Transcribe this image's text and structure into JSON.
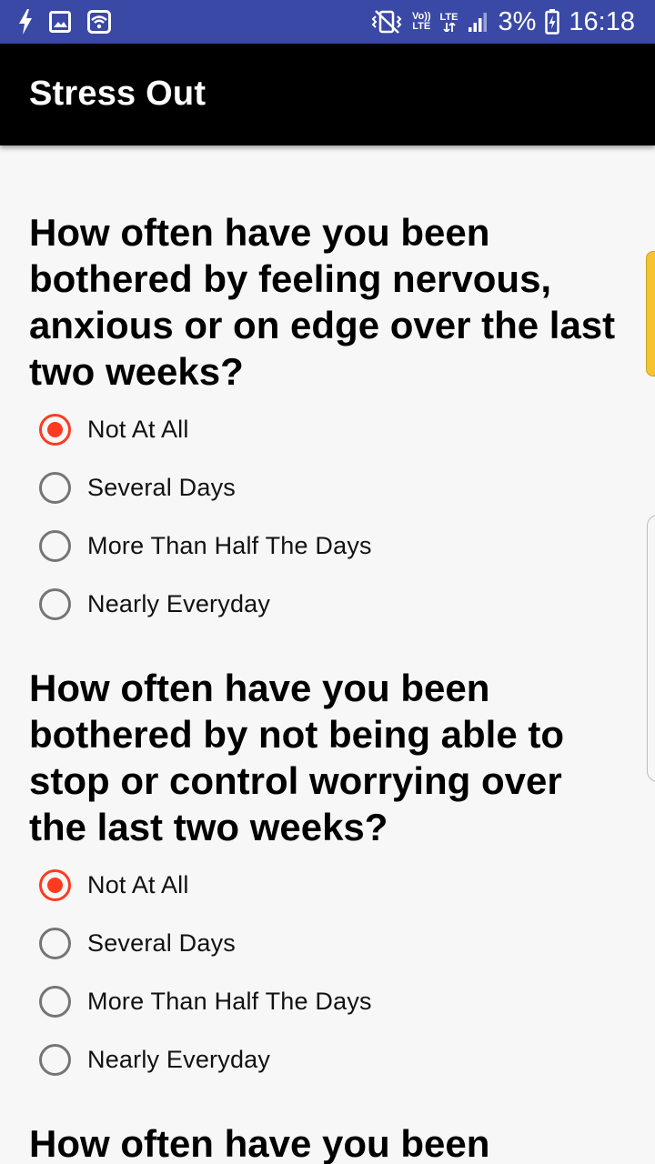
{
  "status_bar": {
    "battery_percent": "3%",
    "time": "16:18",
    "volte_label_top": "Vo))",
    "volte_label_bottom": "LTE",
    "lte_label": "LTE",
    "icons": [
      "flash-icon",
      "image-icon",
      "wifi-icon",
      "vibrate-icon",
      "volte-icon",
      "lte-data-icon",
      "signal-icon",
      "battery-charging-icon"
    ],
    "background_color": "#3a48a6"
  },
  "app_bar": {
    "title": "Stress Out",
    "background_color": "#000000"
  },
  "questions": [
    {
      "text": "How often have you been bothered by feeling nervous, anxious or on edge over the last two weeks?",
      "options": [
        {
          "label": "Not At All",
          "checked": true
        },
        {
          "label": "Several Days",
          "checked": false
        },
        {
          "label": "More Than Half The Days",
          "checked": false
        },
        {
          "label": "Nearly Everyday",
          "checked": false
        }
      ]
    },
    {
      "text": "How often have you been bothered by not being able to stop or control worrying over the last two weeks?",
      "options": [
        {
          "label": "Not At All",
          "checked": true
        },
        {
          "label": "Several Days",
          "checked": false
        },
        {
          "label": "More Than Half The Days",
          "checked": false
        },
        {
          "label": "Nearly Everyday",
          "checked": false
        }
      ]
    },
    {
      "text": "How often have you been"
    }
  ],
  "accent_color": "#ff3b1f"
}
